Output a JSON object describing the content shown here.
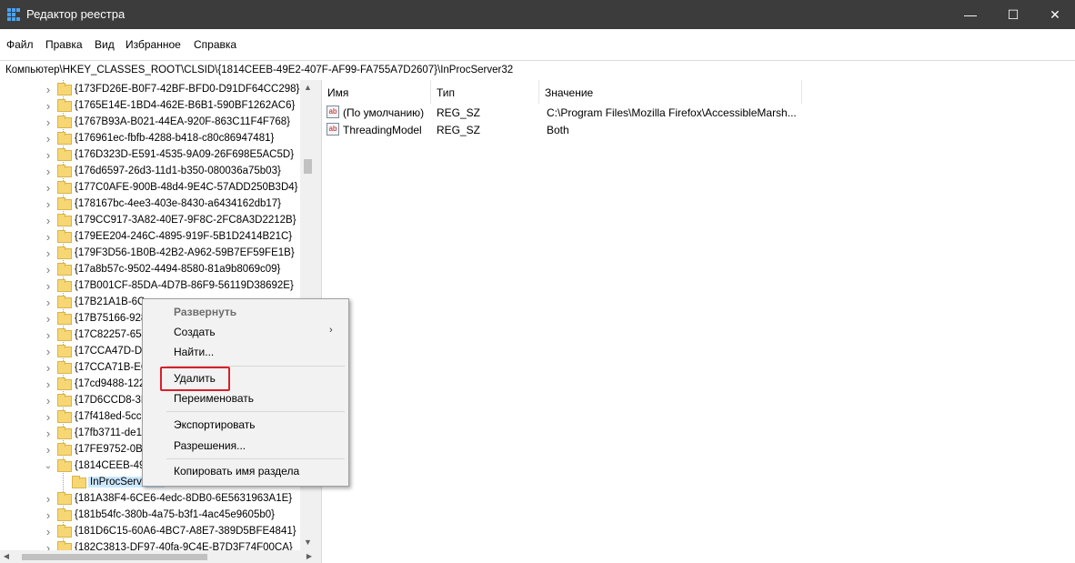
{
  "window": {
    "title": "Редактор реестра",
    "minimize": "—",
    "maximize": "☐",
    "close": "✕"
  },
  "menu": [
    "Файл",
    "Правка",
    "Вид",
    "Избранное",
    "Справка"
  ],
  "address": "Компьютер\\HKEY_CLASSES_ROOT\\CLSID\\{1814CEEB-49E2-407F-AF99-FA755A7D2607}\\InProcServer32",
  "tree": {
    "items": [
      "{173FD26E-B0F7-42BF-BFD0-D91DF64CC298}",
      "{1765E14E-1BD4-462E-B6B1-590BF1262AC6}",
      "{1767B93A-B021-44EA-920F-863C11F4F768}",
      "{176961ec-fbfb-4288-b418-c80c86947481}",
      "{176D323D-E591-4535-9A09-26F698E5AC5D}",
      "{176d6597-26d3-11d1-b350-080036a75b03}",
      "{177C0AFE-900B-48d4-9E4C-57ADD250B3D4}",
      "{178167bc-4ee3-403e-8430-a6434162db17}",
      "{179CC917-3A82-40E7-9F8C-2FC8A3D2212B}",
      "{179EE204-246C-4895-919F-5B1D2414B21C}",
      "{179F3D56-1B0B-42B2-A962-59B7EF59FE1B}",
      "{17a8b57c-9502-4494-8580-81a9b8069c09}",
      "{17B001CF-85DA-4D7B-86F9-56119D38692E}",
      "{17B21A1B-6C",
      "{17B75166-928",
      "{17C82257-654",
      "{17CCA47D-D",
      "{17CCA71B-EC",
      "{17cd9488-122",
      "{17D6CCD8-3B",
      "{17f418ed-5cc",
      "{17fb3711-de1",
      "{17FE9752-0B5",
      "{1814CEEB-49",
      "InProcServer32",
      "{181A38F4-6CE6-4edc-8DB0-6E5631963A1E}",
      "{181b54fc-380b-4a75-b3f1-4ac45e9605b0}",
      "{181D6C15-60A6-4BC7-A8E7-389D5BFE4841}",
      "{182C3813-DF97-40fa-9C4E-B7D3F74F00CA}"
    ]
  },
  "columns": {
    "name": "Имя",
    "type": "Тип",
    "value": "Значение"
  },
  "values": [
    {
      "name": "(По умолчанию)",
      "type": "REG_SZ",
      "data": "C:\\Program Files\\Mozilla Firefox\\AccessibleMarsh..."
    },
    {
      "name": "ThreadingModel",
      "type": "REG_SZ",
      "data": "Both"
    }
  ],
  "context_menu": {
    "expand": "Развернуть",
    "create": "Создать",
    "find": "Найти...",
    "delete": "Удалить",
    "rename": "Переименовать",
    "export": "Экспортировать",
    "permissions": "Разрешения...",
    "copy_key_name": "Копировать имя раздела"
  },
  "colors": {
    "titlebar": "#3c3c3c",
    "selection": "#cce8ff",
    "highlight_box": "#d8202a",
    "folder": "#f7d774"
  }
}
